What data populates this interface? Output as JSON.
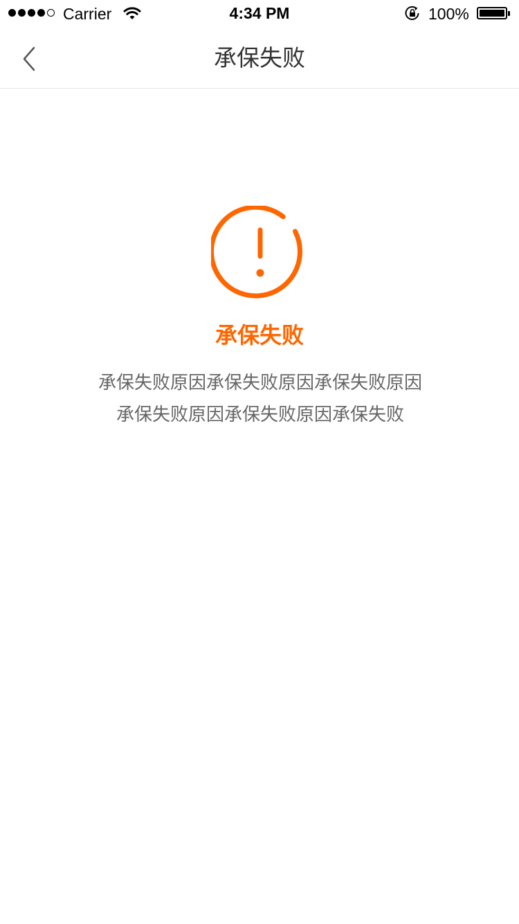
{
  "status_bar": {
    "carrier": "Carrier",
    "time": "4:34 PM",
    "battery": "100%",
    "signal_bars_filled": 4,
    "signal_bars_total": 5,
    "icons": [
      "signal-icon",
      "wifi-icon",
      "rotation-lock-icon",
      "battery-icon"
    ]
  },
  "nav": {
    "title": "承保失败",
    "back_icon": "chevron-left-icon"
  },
  "result": {
    "icon": "exclamation-circle-icon",
    "title": "承保失败",
    "description": "承保失败原因承保失败原因承保失败原因承保失败原因承保失败原因承保失败",
    "accent_color": "#ff6600"
  },
  "colors": {
    "title_text": "#333333",
    "desc_text": "#666666",
    "divider": "#e5e5e5",
    "background": "#ffffff"
  }
}
